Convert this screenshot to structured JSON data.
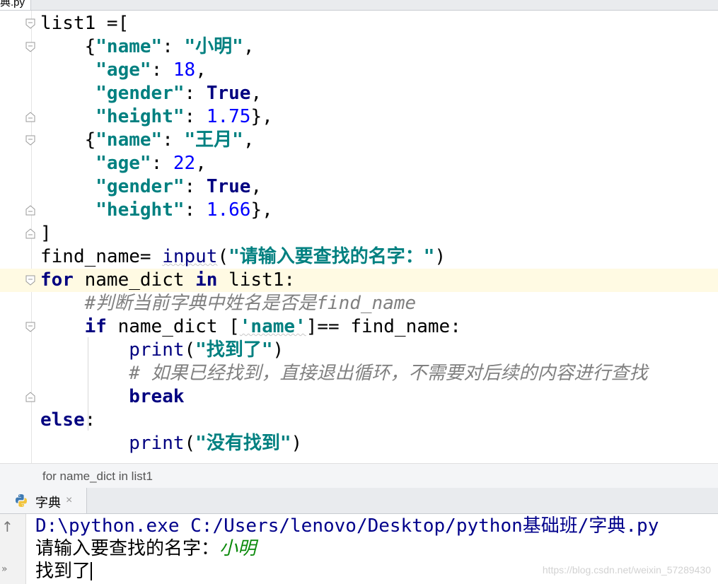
{
  "file_tab": {
    "label": "典.py"
  },
  "code": [
    [
      {
        "t": "list1 =[",
        "c": "lt"
      }
    ],
    [
      {
        "t": "    {",
        "c": "lt"
      },
      {
        "t": "\"name\"",
        "c": "str"
      },
      {
        "t": ": ",
        "c": "lt"
      },
      {
        "t": "\"小明\"",
        "c": "str"
      },
      {
        "t": ",",
        "c": "lt"
      }
    ],
    [
      {
        "t": "     ",
        "c": "lt"
      },
      {
        "t": "\"age\"",
        "c": "str"
      },
      {
        "t": ": ",
        "c": "lt"
      },
      {
        "t": "18",
        "c": "num"
      },
      {
        "t": ",",
        "c": "lt"
      }
    ],
    [
      {
        "t": "     ",
        "c": "lt"
      },
      {
        "t": "\"gender\"",
        "c": "str"
      },
      {
        "t": ": ",
        "c": "lt"
      },
      {
        "t": "True",
        "c": "kw"
      },
      {
        "t": ",",
        "c": "lt"
      }
    ],
    [
      {
        "t": "     ",
        "c": "lt"
      },
      {
        "t": "\"height\"",
        "c": "str"
      },
      {
        "t": ": ",
        "c": "lt"
      },
      {
        "t": "1.75",
        "c": "num"
      },
      {
        "t": "},",
        "c": "lt"
      }
    ],
    [
      {
        "t": "    {",
        "c": "lt"
      },
      {
        "t": "\"name\"",
        "c": "str"
      },
      {
        "t": ": ",
        "c": "lt"
      },
      {
        "t": "\"王月\"",
        "c": "str"
      },
      {
        "t": ",",
        "c": "lt"
      }
    ],
    [
      {
        "t": "     ",
        "c": "lt"
      },
      {
        "t": "\"age\"",
        "c": "str"
      },
      {
        "t": ": ",
        "c": "lt"
      },
      {
        "t": "22",
        "c": "num"
      },
      {
        "t": ",",
        "c": "lt"
      }
    ],
    [
      {
        "t": "     ",
        "c": "lt"
      },
      {
        "t": "\"gender\"",
        "c": "str"
      },
      {
        "t": ": ",
        "c": "lt"
      },
      {
        "t": "True",
        "c": "kw"
      },
      {
        "t": ",",
        "c": "lt"
      }
    ],
    [
      {
        "t": "     ",
        "c": "lt"
      },
      {
        "t": "\"height\"",
        "c": "str"
      },
      {
        "t": ": ",
        "c": "lt"
      },
      {
        "t": "1.66",
        "c": "num"
      },
      {
        "t": "},",
        "c": "lt"
      }
    ],
    [
      {
        "t": "]",
        "c": "lt"
      }
    ],
    [
      {
        "t": "find_name= ",
        "c": "lt"
      },
      {
        "t": "input",
        "c": "bi"
      },
      {
        "t": "(",
        "c": "lt"
      },
      {
        "t": "\"请输入要查找的名字：\"",
        "c": "str"
      },
      {
        "t": ")",
        "c": "lt"
      }
    ],
    [
      {
        "t": "for",
        "c": "kw"
      },
      {
        "t": " name_dict ",
        "c": "lt"
      },
      {
        "t": "in",
        "c": "kw"
      },
      {
        "t": " list1:",
        "c": "lt"
      }
    ],
    [
      {
        "t": "    ",
        "c": "lt"
      },
      {
        "t": "#判断当前字典中姓名是否是find_name",
        "c": "cm"
      }
    ],
    [
      {
        "t": "    ",
        "c": "lt"
      },
      {
        "t": "if",
        "c": "kw"
      },
      {
        "t": " name_dict [",
        "c": "lt"
      },
      {
        "t": "'name'",
        "c": "str"
      },
      {
        "t": "]== find_name:",
        "c": "lt"
      }
    ],
    [
      {
        "t": "        ",
        "c": "lt"
      },
      {
        "t": "print",
        "c": "bi"
      },
      {
        "t": "(",
        "c": "lt"
      },
      {
        "t": "\"找到了\"",
        "c": "str"
      },
      {
        "t": ")",
        "c": "lt"
      }
    ],
    [
      {
        "t": "        ",
        "c": "lt"
      },
      {
        "t": "# 如果已经找到，直接退出循环，不需要对后续的内容进行查找",
        "c": "cm"
      }
    ],
    [
      {
        "t": "        ",
        "c": "lt"
      },
      {
        "t": "break",
        "c": "kw"
      }
    ],
    [
      {
        "t": "else",
        "c": "kw"
      },
      {
        "t": ":",
        "c": "lt"
      }
    ],
    [
      {
        "t": "        ",
        "c": "lt"
      },
      {
        "t": "print",
        "c": "bi"
      },
      {
        "t": "(",
        "c": "lt"
      },
      {
        "t": "\"没有找到\"",
        "c": "str"
      },
      {
        "t": ")",
        "c": "lt"
      }
    ]
  ],
  "breadcrumb": "for name_dict in list1",
  "run_tab": {
    "label": "字典",
    "close": "×"
  },
  "console": {
    "command": "D:\\python.exe C:/Users/lenovo/Desktop/python基础班/字典.py",
    "prompt": "请输入要查找的名字：",
    "user_input": "小明",
    "result": "找到了"
  },
  "watermark": "https://blog.csdn.net/weixin_57289430",
  "colors": {
    "keyword": "#000080",
    "string": "#008080",
    "number": "#0000ff",
    "comment": "#808080",
    "current_line": "#fffae3",
    "console_input": "#0b8a0b"
  }
}
